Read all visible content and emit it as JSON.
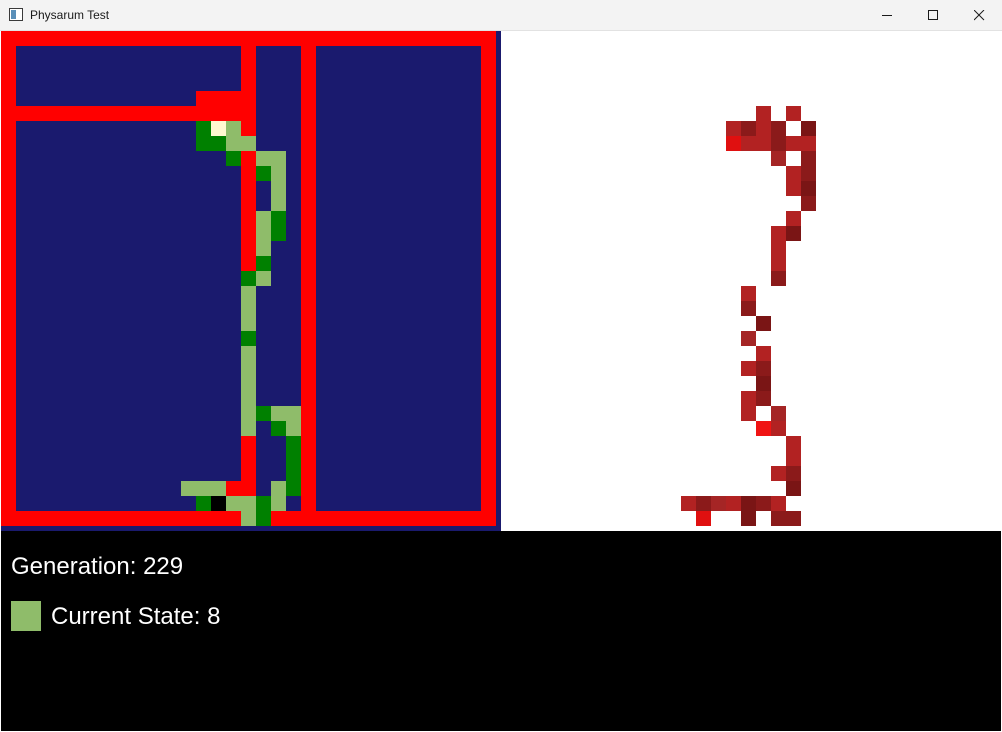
{
  "window": {
    "title": "Physarum Test"
  },
  "colors": {
    "wall": "#ff0000",
    "empty": "#1a1a6e",
    "trail_light": "#8fbc6a",
    "trail_dark": "#008000",
    "trail_cream": "#fff8d0",
    "trail_black": "#000000",
    "heat_a": "#b22222",
    "heat_b": "#8b1a1a",
    "heat_c": "#e01010",
    "heat_d": "#7a1515",
    "heat_e": "#a52525",
    "heat_f": "#f01414",
    "status_bg": "#000000",
    "status_text": "#ffffff",
    "state_color": "#8fbc6a"
  },
  "status": {
    "generation_label": "Generation: 229",
    "current_state_label": "Current State: 8"
  },
  "grid": {
    "size": 33,
    "walls_h": [
      [
        0,
        0,
        32
      ],
      [
        32,
        0,
        32
      ],
      [
        5,
        0,
        16
      ],
      [
        4,
        13,
        15
      ],
      [
        30,
        13,
        15
      ]
    ],
    "walls_v": [
      [
        0,
        0,
        32
      ],
      [
        32,
        0,
        32
      ],
      [
        16,
        0,
        32
      ],
      [
        20,
        0,
        32
      ]
    ],
    "trail": {
      "light": [
        [
          6,
          14
        ],
        [
          6,
          15
        ],
        [
          7,
          15
        ],
        [
          7,
          16
        ],
        [
          8,
          17
        ],
        [
          8,
          18
        ],
        [
          9,
          18
        ],
        [
          10,
          18
        ],
        [
          11,
          18
        ],
        [
          12,
          17
        ],
        [
          13,
          17
        ],
        [
          14,
          17
        ],
        [
          15,
          17
        ],
        [
          16,
          17
        ],
        [
          17,
          16
        ],
        [
          18,
          16
        ],
        [
          19,
          16
        ],
        [
          20,
          16
        ],
        [
          21,
          16
        ],
        [
          22,
          16
        ],
        [
          23,
          16
        ],
        [
          24,
          16
        ],
        [
          25,
          16
        ],
        [
          26,
          16
        ],
        [
          25,
          17
        ],
        [
          25,
          18
        ],
        [
          25,
          19
        ],
        [
          26,
          19
        ],
        [
          27,
          19
        ],
        [
          28,
          19
        ],
        [
          29,
          19
        ],
        [
          30,
          18
        ],
        [
          31,
          18
        ],
        [
          31,
          16
        ],
        [
          31,
          15
        ],
        [
          32,
          16
        ],
        [
          30,
          12
        ],
        [
          30,
          13
        ],
        [
          30,
          14
        ],
        [
          31,
          14
        ]
      ],
      "dark": [
        [
          6,
          13
        ],
        [
          7,
          13
        ],
        [
          7,
          14
        ],
        [
          8,
          15
        ],
        [
          9,
          17
        ],
        [
          12,
          18
        ],
        [
          13,
          18
        ],
        [
          15,
          17
        ],
        [
          16,
          16
        ],
        [
          20,
          16
        ],
        [
          25,
          17
        ],
        [
          26,
          18
        ],
        [
          27,
          19
        ],
        [
          28,
          19
        ],
        [
          29,
          19
        ],
        [
          30,
          19
        ],
        [
          31,
          13
        ],
        [
          31,
          17
        ],
        [
          32,
          17
        ]
      ],
      "cream": [
        [
          6,
          14
        ]
      ],
      "black": [
        [
          31,
          14
        ]
      ]
    },
    "heat": [
      [
        5,
        17,
        "a"
      ],
      [
        5,
        19,
        "a"
      ],
      [
        6,
        15,
        "a"
      ],
      [
        6,
        16,
        "b"
      ],
      [
        6,
        17,
        "a"
      ],
      [
        6,
        18,
        "b"
      ],
      [
        6,
        20,
        "d"
      ],
      [
        7,
        15,
        "c"
      ],
      [
        7,
        16,
        "a"
      ],
      [
        7,
        17,
        "a"
      ],
      [
        7,
        18,
        "b"
      ],
      [
        7,
        19,
        "a"
      ],
      [
        7,
        20,
        "a"
      ],
      [
        8,
        18,
        "e"
      ],
      [
        8,
        20,
        "b"
      ],
      [
        9,
        19,
        "a"
      ],
      [
        9,
        20,
        "b"
      ],
      [
        10,
        19,
        "a"
      ],
      [
        10,
        20,
        "d"
      ],
      [
        11,
        20,
        "b"
      ],
      [
        12,
        19,
        "a"
      ],
      [
        13,
        18,
        "a"
      ],
      [
        13,
        19,
        "d"
      ],
      [
        14,
        18,
        "a"
      ],
      [
        15,
        18,
        "a"
      ],
      [
        16,
        18,
        "b"
      ],
      [
        17,
        16,
        "a"
      ],
      [
        18,
        16,
        "b"
      ],
      [
        19,
        17,
        "d"
      ],
      [
        20,
        16,
        "e"
      ],
      [
        21,
        17,
        "a"
      ],
      [
        22,
        16,
        "a"
      ],
      [
        22,
        17,
        "b"
      ],
      [
        23,
        17,
        "d"
      ],
      [
        24,
        16,
        "a"
      ],
      [
        24,
        17,
        "b"
      ],
      [
        25,
        16,
        "a"
      ],
      [
        25,
        18,
        "e"
      ],
      [
        26,
        17,
        "f"
      ],
      [
        26,
        18,
        "a"
      ],
      [
        27,
        19,
        "a"
      ],
      [
        28,
        19,
        "a"
      ],
      [
        29,
        18,
        "a"
      ],
      [
        29,
        19,
        "b"
      ],
      [
        30,
        19,
        "d"
      ],
      [
        31,
        18,
        "b"
      ],
      [
        31,
        12,
        "a"
      ],
      [
        31,
        13,
        "b"
      ],
      [
        31,
        14,
        "e"
      ],
      [
        31,
        15,
        "a"
      ],
      [
        31,
        16,
        "d"
      ],
      [
        31,
        17,
        "b"
      ],
      [
        31,
        18,
        "a"
      ],
      [
        32,
        13,
        "c"
      ],
      [
        32,
        16,
        "d"
      ],
      [
        32,
        18,
        "b"
      ],
      [
        32,
        19,
        "b"
      ]
    ]
  }
}
